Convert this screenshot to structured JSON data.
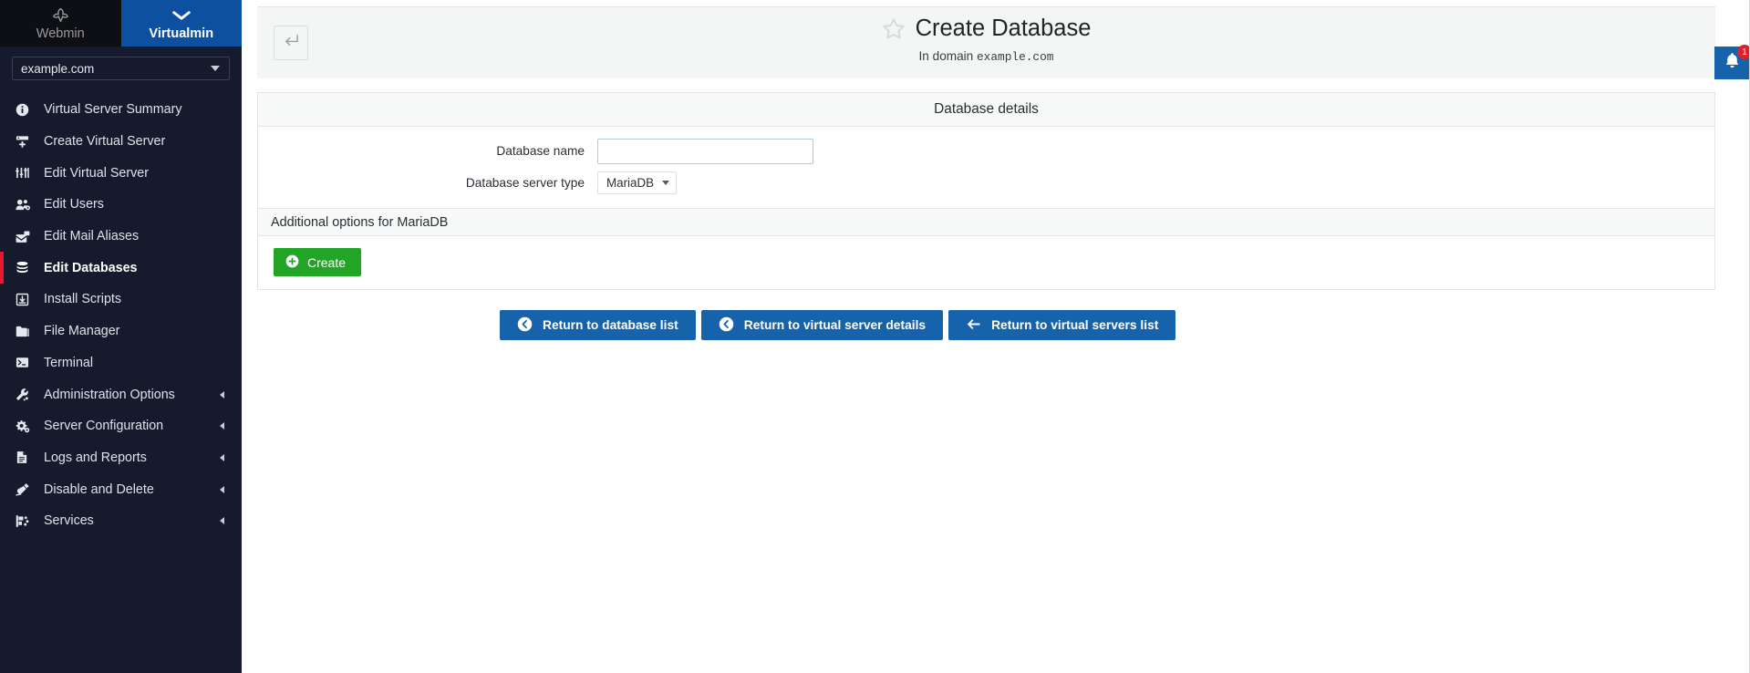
{
  "sidebar": {
    "tabs": [
      {
        "label": "Webmin",
        "icon": "webmin-logo-icon",
        "active": false
      },
      {
        "label": "Virtualmin",
        "icon": "chevron-down-icon",
        "active": true
      }
    ],
    "domain_selector": {
      "value": "example.com",
      "icon": "caret-down-icon"
    },
    "items": [
      {
        "label": "Virtual Server Summary",
        "icon": "info-circle-icon",
        "active": false,
        "expandable": false
      },
      {
        "label": "Create Virtual Server",
        "icon": "server-plus-icon",
        "active": false,
        "expandable": false
      },
      {
        "label": "Edit Virtual Server",
        "icon": "sliders-icon",
        "active": false,
        "expandable": false
      },
      {
        "label": "Edit Users",
        "icon": "users-gear-icon",
        "active": false,
        "expandable": false
      },
      {
        "label": "Edit Mail Aliases",
        "icon": "mail-stack-icon",
        "active": false,
        "expandable": false
      },
      {
        "label": "Edit Databases",
        "icon": "database-icon",
        "active": true,
        "expandable": false
      },
      {
        "label": "Install Scripts",
        "icon": "download-box-icon",
        "active": false,
        "expandable": false
      },
      {
        "label": "File Manager",
        "icon": "folder-icon",
        "active": false,
        "expandable": false
      },
      {
        "label": "Terminal",
        "icon": "terminal-icon",
        "active": false,
        "expandable": false
      },
      {
        "label": "Administration Options",
        "icon": "wrench-icon",
        "active": false,
        "expandable": true
      },
      {
        "label": "Server Configuration",
        "icon": "gears-icon",
        "active": false,
        "expandable": true
      },
      {
        "label": "Logs and Reports",
        "icon": "file-lines-icon",
        "active": false,
        "expandable": true
      },
      {
        "label": "Disable and Delete",
        "icon": "plug-icon",
        "active": false,
        "expandable": true
      },
      {
        "label": "Services",
        "icon": "services-icon",
        "active": false,
        "expandable": true
      }
    ]
  },
  "header": {
    "back_button_icon": "return-arrow-icon",
    "star_icon": "star-outline-icon",
    "title": "Create Database",
    "subtitle_prefix": "In domain",
    "subtitle_domain": "example.com"
  },
  "panel": {
    "heading": "Database details",
    "fields": [
      {
        "label": "Database name",
        "type": "text",
        "value": "",
        "placeholder": ""
      },
      {
        "label": "Database server type",
        "type": "select",
        "value": "MariaDB"
      }
    ],
    "subheading": "Additional options for MariaDB",
    "create_button": {
      "label": "Create",
      "icon": "plus-circle-icon"
    }
  },
  "bottom_nav": [
    {
      "label": "Return to database list",
      "icon": "arrow-circle-left-icon"
    },
    {
      "label": "Return to virtual server details",
      "icon": "arrow-circle-left-icon"
    },
    {
      "label": "Return to virtual servers list",
      "icon": "arrow-left-icon"
    }
  ],
  "notification": {
    "icon": "bell-icon",
    "count": "1"
  },
  "colors": {
    "sidebar_bg": "#151b2d",
    "webmin_tab_bg": "#0d0f14",
    "virtualmin_tab_bg": "#0e50a0",
    "active_marker": "#e8192c",
    "primary_blue": "#1763ab",
    "create_green": "#22a527",
    "badge_red": "#d9242b"
  }
}
